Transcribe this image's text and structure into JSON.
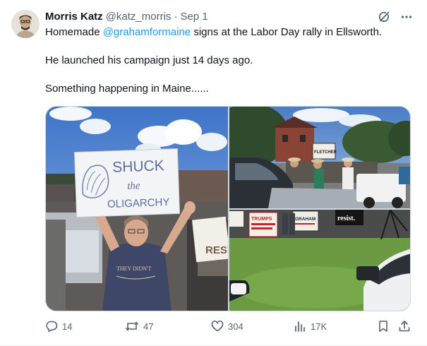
{
  "tweet": {
    "author_name": "Morris Katz",
    "author_handle": "@katz_morris",
    "separator": "·",
    "date": "Sep 1",
    "text_before_mention": "Homemade ",
    "mention": "@grahamformaine",
    "text_after_mention": " signs at the Labor Day rally in Ellsworth.",
    "paragraph_2": "He launched his campaign just 14 days ago.",
    "paragraph_3": "Something happening in Maine......"
  },
  "photos": {
    "left_sign_line1": "SHUCK",
    "left_sign_line2": "the",
    "left_sign_line3": "OLIGARCHY",
    "left_side_sign": "RESIS",
    "left_shirt_text": "THEY DIDN'T",
    "top_right_sign": "FLETCHER",
    "bottom_right_sign_resist": "resist.",
    "bottom_right_sign_trump": "TRUMPS",
    "bottom_right_sign_graham": "GRAHAM"
  },
  "actions": {
    "replies": "14",
    "reposts": "47",
    "likes": "304",
    "views": "17K"
  },
  "icons": {
    "top": [
      "grok-icon",
      "more-icon"
    ],
    "actions": [
      "reply-icon",
      "repost-icon",
      "like-icon",
      "views-icon",
      "bookmark-icon",
      "share-icon"
    ]
  },
  "colors": {
    "text": "#0f1419",
    "secondary": "#536471",
    "link": "#1d9bf0"
  }
}
